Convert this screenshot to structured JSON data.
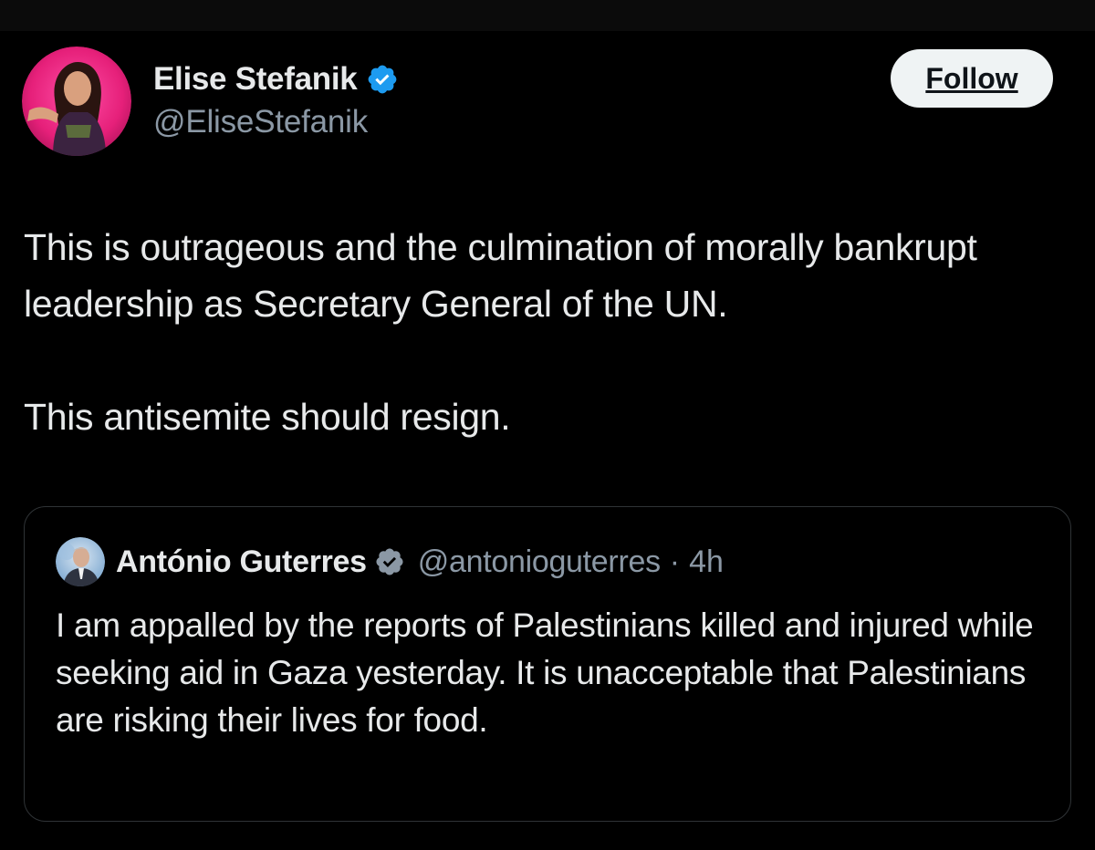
{
  "author": {
    "name": "Elise Stefanik",
    "handle": "@EliseStefanik",
    "avatar_icon": "profile-photo",
    "verified_icon": "verified-badge-icon",
    "verified_color": "#1d9bf0"
  },
  "follow_button": {
    "label": "Follow"
  },
  "tweet": {
    "paragraphs": [
      "This is outrageous and the culmination of morally bankrupt leadership as Secretary General of the UN.",
      "This antisemite should resign."
    ]
  },
  "quoted_tweet": {
    "name": "António Guterres",
    "handle": "@antonioguterres",
    "separator": "·",
    "time": "4h",
    "text": "I am appalled by the reports of Palestinians killed and injured while seeking aid in Gaza yesterday. It is unacceptable that Palestinians are risking their lives for food."
  },
  "colors": {
    "background": "#000000",
    "text_primary": "#e7e9ea",
    "text_secondary": "#8b98a5",
    "border": "#2f3336",
    "accent": "#1d9bf0",
    "avatar_ring": "#e6207a"
  }
}
